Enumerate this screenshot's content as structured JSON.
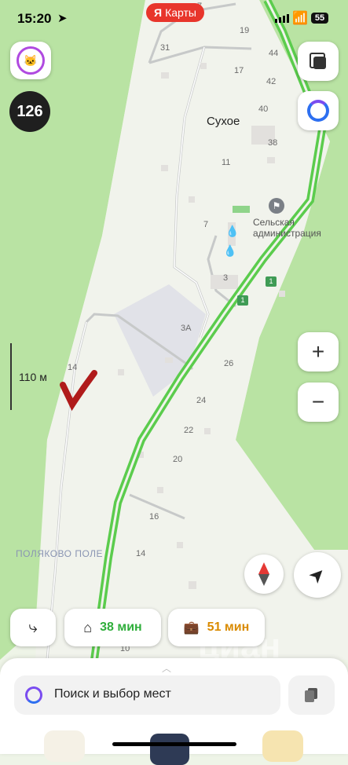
{
  "status_bar": {
    "time": "15:20",
    "battery": "55"
  },
  "app_badge": "Карты",
  "counter_badge": "126",
  "scale": {
    "label": "110 м"
  },
  "map": {
    "place_name": "Сухое",
    "poi_label": "Сельская администрация",
    "area_label": "ПОЛЯКОВО ПОЛЕ",
    "house_numbers": [
      {
        "id": "h7top",
        "text": "7"
      },
      {
        "id": "h31",
        "text": "31"
      },
      {
        "id": "h19",
        "text": "19"
      },
      {
        "id": "h17",
        "text": "17"
      },
      {
        "id": "h44",
        "text": "44"
      },
      {
        "id": "h42",
        "text": "42"
      },
      {
        "id": "h40",
        "text": "40"
      },
      {
        "id": "h38",
        "text": "38"
      },
      {
        "id": "h11",
        "text": "11"
      },
      {
        "id": "h7",
        "text": "7"
      },
      {
        "id": "h3",
        "text": "3"
      },
      {
        "id": "h3a",
        "text": "3А"
      },
      {
        "id": "h14a",
        "text": "14"
      },
      {
        "id": "h26",
        "text": "26"
      },
      {
        "id": "h24",
        "text": "24"
      },
      {
        "id": "h22",
        "text": "22"
      },
      {
        "id": "h20",
        "text": "20"
      },
      {
        "id": "h16",
        "text": "16"
      },
      {
        "id": "h14b",
        "text": "14"
      },
      {
        "id": "h10",
        "text": "10"
      }
    ],
    "road_shield": "1"
  },
  "routes": {
    "home_time": "38 мин",
    "work_time": "51 мин",
    "home_color": "#2fae3b",
    "work_color": "#d98a00"
  },
  "search": {
    "placeholder": "Поиск и выбор мест"
  },
  "watermark": "циан",
  "colors": {
    "route_line": "#5bcc4d",
    "badge_red": "#e8352b",
    "map_bg": "#eef4e7",
    "forest": "#b9e3a3"
  }
}
